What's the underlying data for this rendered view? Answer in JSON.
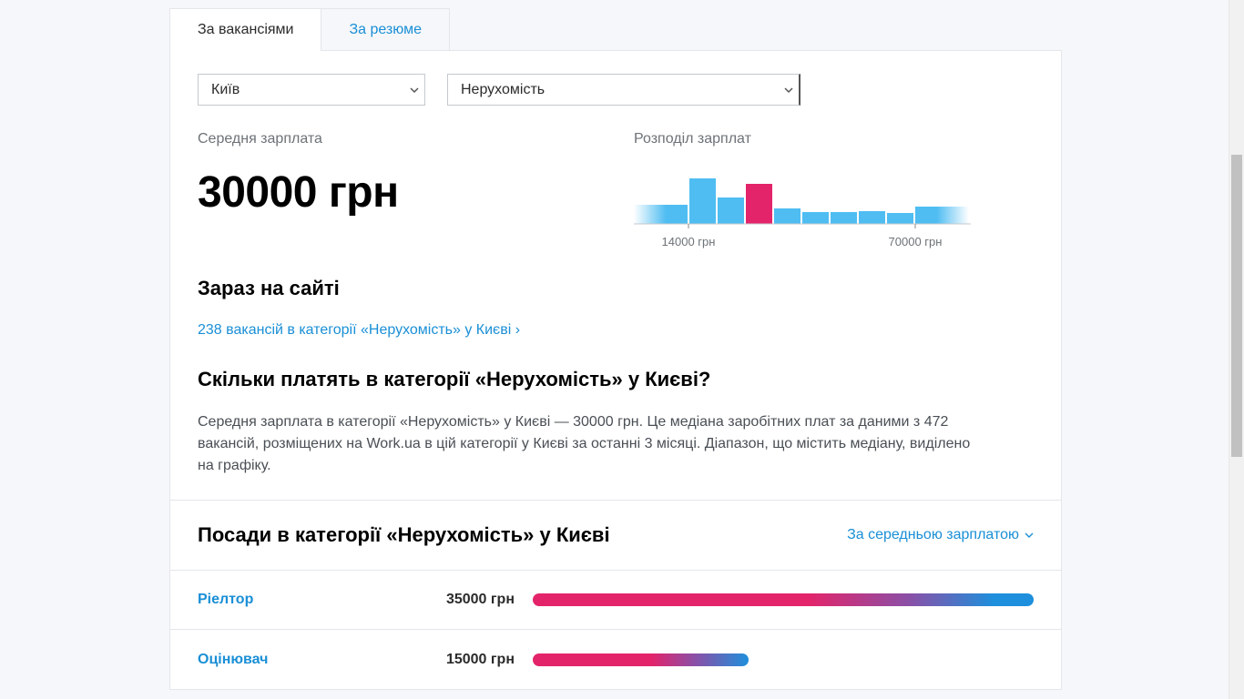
{
  "tabs": [
    {
      "label": "За вакансіями",
      "active": true
    },
    {
      "label": "За резюме",
      "active": false
    }
  ],
  "filters": {
    "city": "Київ",
    "category": "Нерухомість"
  },
  "average": {
    "label": "Середня зарплата",
    "value": "30000 грн"
  },
  "distribution": {
    "label": "Розподіл зарплат",
    "ticks": [
      "14000 грн",
      "70000 грн"
    ]
  },
  "chart_data": {
    "type": "bar",
    "note_levels": [
      0.42,
      1.0,
      0.58,
      0.88,
      0.34,
      0.26,
      0.26,
      0.28,
      0.24,
      0.38
    ],
    "highlight_index": 3,
    "colors": {
      "bar": "#4fbdf2",
      "highlight": "#e3246a"
    }
  },
  "now": {
    "title": "Зараз на сайті",
    "link": "238 вакансій в категорії «Нерухомість» у Києві ›"
  },
  "how": {
    "title": "Скільки платять в категорії «Нерухомість» у Києві?",
    "text": "Середня зарплата в категорії «Нерухомість» у Києві — 30000 грн. Це медіана заробітних плат за даними з 472 вакансій, розміщених на Work.ua в цій категорії у Києві за останні 3 місяці. Діапазон, що містить медіану, виділено на графіку."
  },
  "positions": {
    "title": "Посади в категорії «Нерухомість» у Києві",
    "sort_label": "За середньою зарплатою",
    "items": [
      {
        "name": "Ріелтор",
        "salary": "35000 грн",
        "level": 1.0
      },
      {
        "name": "Оцінювач",
        "salary": "15000 грн",
        "level": 0.43
      }
    ]
  }
}
